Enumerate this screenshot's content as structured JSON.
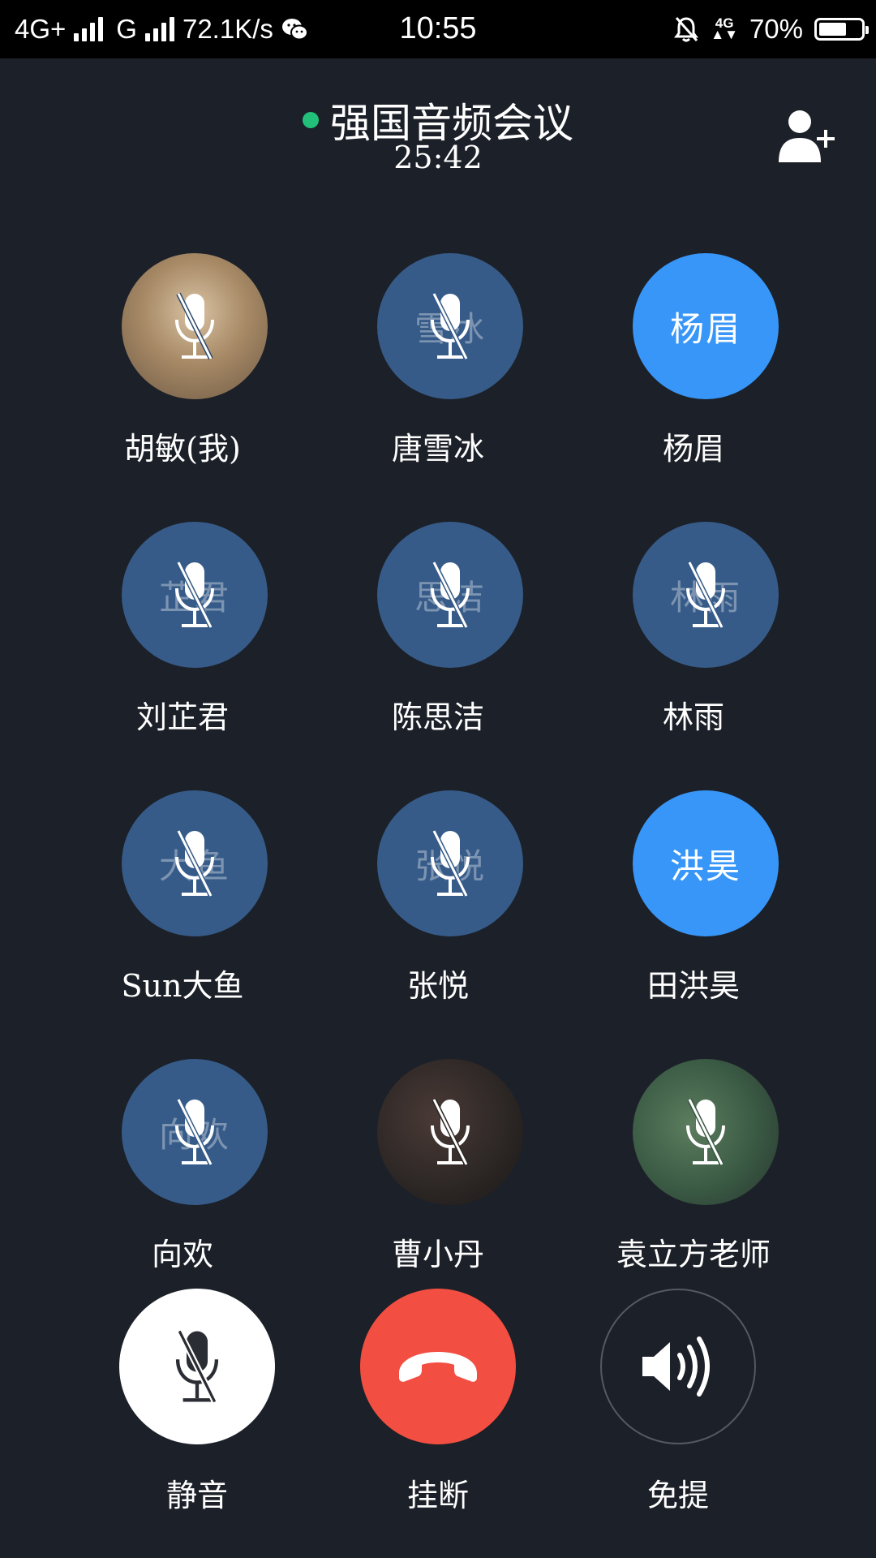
{
  "status_bar": {
    "network1": "4G+",
    "network2": "G",
    "speed": "72.1K/s",
    "time": "10:55",
    "network3": "4G",
    "battery_percent": "70%",
    "battery_level": 0.7,
    "icons": [
      "signal-icon",
      "wechat-icon",
      "alarm-muted-icon",
      "battery-icon"
    ]
  },
  "header": {
    "title": "强国音频会议",
    "duration": "25:42",
    "status_color": "#21c17a",
    "add_member_icon": "add-user-icon"
  },
  "participants": [
    {
      "name": "胡敏(我)",
      "avatar_text": "",
      "avatar": "photo",
      "muted": true
    },
    {
      "name": "唐雪冰",
      "avatar_text": "雪冰",
      "avatar": "initials",
      "muted": true
    },
    {
      "name": "杨眉",
      "avatar_text": "杨眉",
      "avatar": "speaking",
      "muted": false
    },
    {
      "name": "刘芷君",
      "avatar_text": "芷君",
      "avatar": "initials",
      "muted": true
    },
    {
      "name": "陈思洁",
      "avatar_text": "思洁",
      "avatar": "initials",
      "muted": true
    },
    {
      "name": "林雨",
      "avatar_text": "林雨",
      "avatar": "initials",
      "muted": true
    },
    {
      "name": "Sun大鱼",
      "avatar_text": "大鱼",
      "avatar": "initials",
      "muted": true
    },
    {
      "name": "张悦",
      "avatar_text": "张悦",
      "avatar": "initials",
      "muted": true
    },
    {
      "name": "田洪昊",
      "avatar_text": "洪昊",
      "avatar": "speaking",
      "muted": false
    },
    {
      "name": "向欢",
      "avatar_text": "向欢",
      "avatar": "initials",
      "muted": true
    },
    {
      "name": "曹小丹",
      "avatar_text": "",
      "avatar": "photo",
      "muted": true
    },
    {
      "name": "袁立方老师",
      "avatar_text": "",
      "avatar": "photo",
      "muted": true
    }
  ],
  "controls": {
    "mute_label": "静音",
    "hangup_label": "挂断",
    "speaker_label": "免提",
    "hangup_color": "#f24f42"
  }
}
